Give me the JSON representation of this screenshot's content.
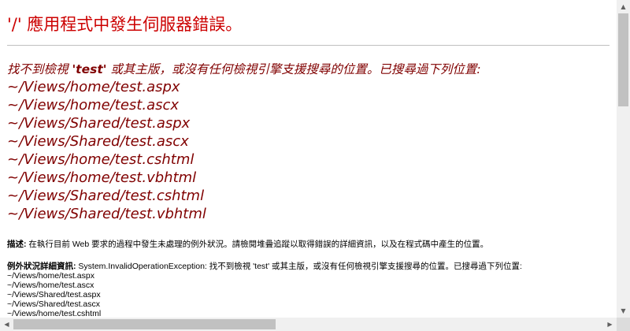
{
  "page": {
    "title": "'/' 應用程式中發生伺服器錯誤。",
    "heading_prefix": "找不到檢視 ",
    "heading_view": "'test'",
    "heading_suffix": " 或其主版，或沒有任何檢視引擎支援搜尋的位置。已搜尋過下列位置:",
    "searched_locations": [
      "~/Views/home/test.aspx",
      "~/Views/home/test.ascx",
      "~/Views/Shared/test.aspx",
      "~/Views/Shared/test.ascx",
      "~/Views/home/test.cshtml",
      "~/Views/home/test.vbhtml",
      "~/Views/Shared/test.cshtml",
      "~/Views/Shared/test.vbhtml"
    ],
    "description_label": "描述:",
    "description_text": " 在執行目前 Web 要求的過程中發生未處理的例外狀況。請檢閱堆疊追蹤以取得錯誤的詳細資訊，以及在程式碼中產生的位置。",
    "exception_label": "例外狀況詳細資訊:",
    "exception_text": " System.InvalidOperationException: 找不到檢視 'test' 或其主版，或沒有任何檢視引擎支援搜尋的位置。已搜尋過下列位置:",
    "exception_locations": [
      "~/Views/home/test.aspx",
      "~/Views/home/test.ascx",
      "~/Views/Shared/test.aspx",
      "~/Views/Shared/test.ascx",
      "~/Views/home/test.cshtml"
    ]
  },
  "scrollbars": {
    "up_arrow": "▲",
    "down_arrow": "▼",
    "left_arrow": "◀",
    "right_arrow": "▶"
  }
}
